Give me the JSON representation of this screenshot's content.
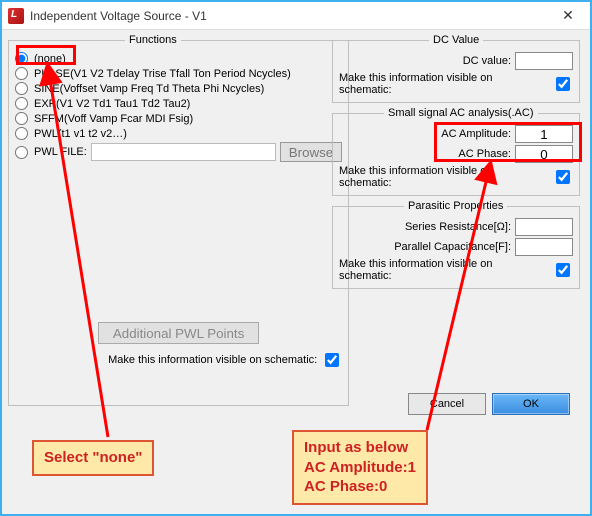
{
  "title": "Independent Voltage Source - V1",
  "functions": {
    "legend": "Functions",
    "options": [
      {
        "label": "(none)",
        "selected": true
      },
      {
        "label": "PULSE(V1 V2 Tdelay Trise Tfall Ton Period Ncycles)",
        "selected": false
      },
      {
        "label": "SINE(Voffset Vamp Freq Td Theta Phi Ncycles)",
        "selected": false
      },
      {
        "label": "EXP(V1 V2 Td1 Tau1 Td2 Tau2)",
        "selected": false
      },
      {
        "label": "SFFM(Voff Vamp Fcar MDI Fsig)",
        "selected": false
      },
      {
        "label": "PWL(t1 v1 t2 v2…)",
        "selected": false
      },
      {
        "label": "PWL FILE:",
        "selected": false
      }
    ],
    "browse_label": "Browse",
    "addpwl_label": "Additional PWL Points",
    "visible_label": "Make this information visible on schematic:",
    "visible_checked": true
  },
  "dc": {
    "legend": "DC Value",
    "dcvalue_label": "DC value:",
    "dcvalue": "",
    "visible_label": "Make this information visible on schematic:",
    "visible_checked": true
  },
  "ac": {
    "legend": "Small signal AC analysis(.AC)",
    "amp_label": "AC Amplitude:",
    "amp_value": "1",
    "phase_label": "AC Phase:",
    "phase_value": "0",
    "visible_label": "Make this information visible on schematic:",
    "visible_checked": true
  },
  "parasitic": {
    "legend": "Parasitic Properties",
    "r_label": "Series Resistance[Ω]:",
    "r_value": "",
    "c_label": "Parallel Capacitance[F]:",
    "c_value": "",
    "visible_label": "Make this information visible on schematic:",
    "visible_checked": true
  },
  "buttons": {
    "cancel": "Cancel",
    "ok": "OK"
  },
  "annotations": {
    "left": "Select \"none\"",
    "right_line1": "Input as below",
    "right_line2": "AC Amplitude:1",
    "right_line3": "AC Phase:0"
  }
}
